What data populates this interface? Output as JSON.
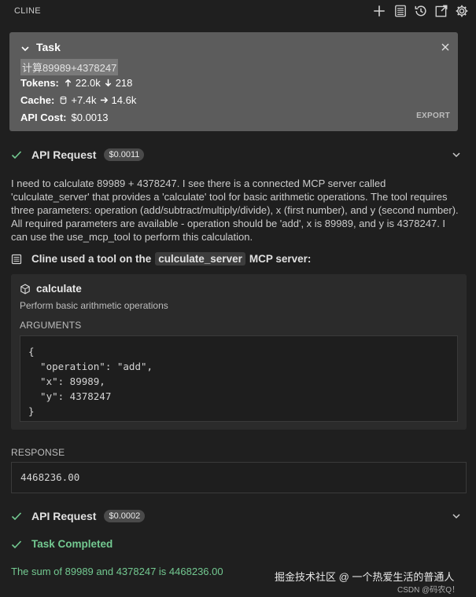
{
  "header": {
    "title": "CLINE",
    "icons": [
      "plus-icon",
      "history-list-icon",
      "history-clock-icon",
      "popout-icon",
      "settings-gear-icon"
    ]
  },
  "task": {
    "title": "Task",
    "query": "计算89989+4378247",
    "tokens_label": "Tokens:",
    "tokens_in": "22.0k",
    "tokens_out": "218",
    "cache_label": "Cache:",
    "cache_write": "+7.4k",
    "cache_read": "14.6k",
    "api_cost_label": "API Cost:",
    "api_cost": "$0.0013",
    "export_label": "EXPORT"
  },
  "request1": {
    "title": "API Request",
    "cost": "$0.0011"
  },
  "reasoning": "I need to calculate 89989 + 4378247. I see there is a connected MCP server called 'culculate_server' that provides a 'calculate' tool for basic arithmetic operations. The tool requires three parameters: operation (add/subtract/multiply/divide), x (first number), and y (second number). All required parameters are available - operation should be 'add', x is 89989, and y is 4378247. I can use the use_mcp_tool to perform this calculation.",
  "tool_use": {
    "prefix": "Cline used a tool on the",
    "server": "culculate_server",
    "suffix": "MCP server:",
    "tool_name": "calculate",
    "tool_description": "Perform basic arithmetic operations",
    "arguments_label": "ARGUMENTS",
    "arguments_code": "{\n  \"operation\": \"add\",\n  \"x\": 89989,\n  \"y\": 4378247\n}"
  },
  "response": {
    "label": "RESPONSE",
    "value": "4468236.00"
  },
  "request2": {
    "title": "API Request",
    "cost": "$0.0002"
  },
  "completion": {
    "title": "Task Completed",
    "text": "The sum of 89989 and 4378247 is 4468236.00"
  },
  "watermark": {
    "text": "掘金技术社区 @ 一个热爱生活的普通人",
    "csdn": "CSDN @码农Q！"
  },
  "colors": {
    "background": "#1f1f1f",
    "task_panel": "#5c5c5c",
    "success": "#73c991"
  }
}
